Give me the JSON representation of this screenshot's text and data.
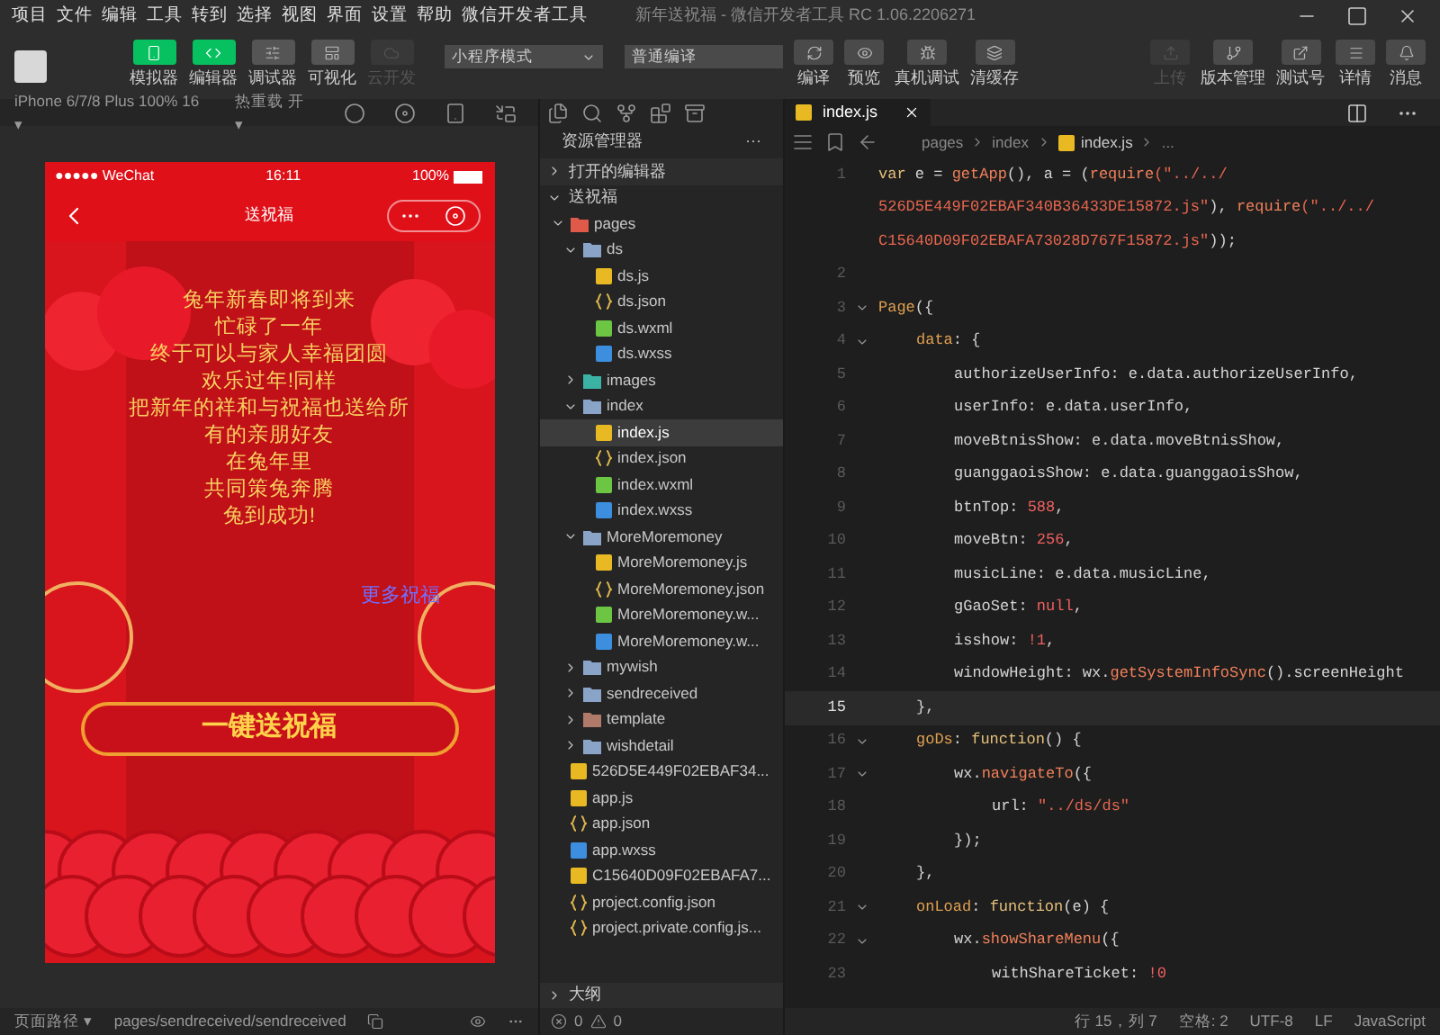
{
  "menu": [
    "项目",
    "文件",
    "编辑",
    "工具",
    "转到",
    "选择",
    "视图",
    "界面",
    "设置",
    "帮助",
    "微信开发者工具"
  ],
  "window": {
    "title": "新年送祝福 - 微信开发者工具 RC 1.06.2206271"
  },
  "toolbar": {
    "view_buttons": [
      {
        "label": "模拟器",
        "kind": "phone",
        "selected": true,
        "disabled": false
      },
      {
        "label": "编辑器",
        "kind": "code",
        "selected": true,
        "disabled": false
      },
      {
        "label": "调试器",
        "kind": "debug",
        "selected": false,
        "disabled": false
      },
      {
        "label": "可视化",
        "kind": "layout",
        "selected": false,
        "disabled": false
      },
      {
        "label": "云开发",
        "kind": "cloud",
        "selected": false,
        "disabled": true
      }
    ],
    "mode_select": "小程序模式",
    "compile_select": "普通编译",
    "actions": [
      {
        "label": "编译",
        "kind": "refresh"
      },
      {
        "label": "预览",
        "kind": "eye"
      },
      {
        "label": "真机调试",
        "kind": "bug"
      },
      {
        "label": "清缓存",
        "kind": "layers"
      }
    ],
    "right_actions": [
      {
        "label": "上传",
        "kind": "upload",
        "disabled": true
      },
      {
        "label": "版本管理",
        "kind": "branch",
        "disabled": false
      },
      {
        "label": "测试号",
        "kind": "external",
        "disabled": false
      },
      {
        "label": "详情",
        "kind": "menu",
        "disabled": false
      },
      {
        "label": "消息",
        "kind": "bell",
        "disabled": false
      }
    ]
  },
  "simulator": {
    "device": "iPhone 6/7/8 Plus 100% 16 ▾",
    "hot_reload": "热重载 开 ▾",
    "status": {
      "carrier": "●●●●● WeChat",
      "time": "16:11",
      "battery": "100%"
    },
    "nav_title": "送祝福",
    "message": [
      "兔年新春即将到来",
      "忙碌了一年",
      "终于可以与家人幸福团圆",
      "欢乐过年!同样",
      "把新年的祥和与祝福也送给所",
      "有的亲朋好友",
      "在兔年里",
      "共同策兔奔腾",
      "兔到成功!"
    ],
    "more_link": "更多祝福",
    "send_button": "一键送祝福"
  },
  "explorer": {
    "title": "资源管理器",
    "menu": "···",
    "open_editors": "打开的编辑器",
    "project": "送祝福",
    "tree": [
      {
        "name": "pages",
        "kind": "pages",
        "expanded": true,
        "selected": false,
        "children": [
          {
            "name": "ds",
            "kind": "folder",
            "expanded": true,
            "selected": false,
            "children": [
              {
                "name": "ds.js",
                "kind": "js",
                "selected": false
              },
              {
                "name": "ds.json",
                "kind": "json",
                "selected": false
              },
              {
                "name": "ds.wxml",
                "kind": "wxml",
                "selected": false
              },
              {
                "name": "ds.wxss",
                "kind": "wxss",
                "selected": false
              }
            ]
          },
          {
            "name": "images",
            "kind": "images",
            "expanded": false,
            "selected": false
          },
          {
            "name": "index",
            "kind": "folder",
            "expanded": true,
            "selected": false,
            "children": [
              {
                "name": "index.js",
                "kind": "js",
                "selected": true
              },
              {
                "name": "index.json",
                "kind": "json",
                "selected": false
              },
              {
                "name": "index.wxml",
                "kind": "wxml",
                "selected": false
              },
              {
                "name": "index.wxss",
                "kind": "wxss",
                "selected": false
              }
            ]
          },
          {
            "name": "MoreMoremoney",
            "kind": "folder",
            "expanded": true,
            "selected": false,
            "children": [
              {
                "name": "MoreMoremoney.js",
                "kind": "js",
                "selected": false
              },
              {
                "name": "MoreMoremoney.json",
                "kind": "json",
                "selected": false
              },
              {
                "name": "MoreMoremoney.w...",
                "kind": "wxml",
                "selected": false
              },
              {
                "name": "MoreMoremoney.w...",
                "kind": "wxss",
                "selected": false
              }
            ]
          },
          {
            "name": "mywish",
            "kind": "folder",
            "expanded": false,
            "selected": false
          },
          {
            "name": "sendreceived",
            "kind": "folder",
            "expanded": false,
            "selected": false
          },
          {
            "name": "template",
            "kind": "template",
            "expanded": false,
            "selected": false
          },
          {
            "name": "wishdetail",
            "kind": "folder",
            "expanded": false,
            "selected": false
          }
        ]
      },
      {
        "name": "526D5E449F02EBAF34...",
        "kind": "js",
        "selected": false
      },
      {
        "name": "app.js",
        "kind": "js",
        "selected": false
      },
      {
        "name": "app.json",
        "kind": "json",
        "selected": false
      },
      {
        "name": "app.wxss",
        "kind": "wxss",
        "selected": false
      },
      {
        "name": "C15640D09F02EBAFA7...",
        "kind": "js",
        "selected": false
      },
      {
        "name": "project.config.json",
        "kind": "json",
        "selected": false
      },
      {
        "name": "project.private.config.js...",
        "kind": "json",
        "selected": false
      }
    ],
    "outline": "大纲",
    "errors": "0",
    "warnings": "0"
  },
  "editor": {
    "tab": "index.js",
    "breadcrumb": [
      "pages",
      "index",
      "index.js",
      "..."
    ],
    "lines": [
      {
        "number": "1",
        "current": false,
        "tokens": [
          {
            "text": "var ",
            "kind": "keyword"
          },
          {
            "text": "e = ",
            "kind": "plain"
          },
          {
            "text": "getApp",
            "kind": "function"
          },
          {
            "text": "(), a = (",
            "kind": "plain"
          },
          {
            "text": "require",
            "kind": "function"
          },
          {
            "text": "(\"../../",
            "kind": "string"
          }
        ]
      },
      {
        "current": false,
        "tokens": [
          {
            "text": "526D5E449F02EBAF340B36433DE15872.js\"",
            "kind": "string"
          },
          {
            "text": "), ",
            "kind": "plain"
          },
          {
            "text": "require",
            "kind": "function"
          },
          {
            "text": "(\"../../",
            "kind": "string"
          }
        ]
      },
      {
        "current": false,
        "tokens": [
          {
            "text": "C15640D09F02EBAFA73028D767F15872.js\"",
            "kind": "string"
          },
          {
            "text": "));",
            "kind": "plain"
          }
        ]
      },
      {
        "number": "2",
        "current": false
      },
      {
        "number": "3",
        "current": false,
        "tokens": [
          {
            "text": "Page",
            "kind": "key"
          },
          {
            "text": "({",
            "kind": "plain"
          }
        ],
        "children": [
          {
            "number": "4",
            "current": false,
            "tokens": [
              {
                "text": "data",
                "kind": "key"
              },
              {
                "text": ": {",
                "kind": "plain"
              }
            ],
            "children": [
              {
                "number": "5",
                "current": false,
                "tokens": [
                  {
                    "text": "authorizeUserInfo: e.data.authorizeUserInfo,",
                    "kind": "plain"
                  }
                ]
              },
              {
                "number": "6",
                "current": false,
                "tokens": [
                  {
                    "text": "userInfo: e.data.userInfo,",
                    "kind": "plain"
                  }
                ]
              },
              {
                "number": "7",
                "current": false,
                "tokens": [
                  {
                    "text": "moveBtnisShow: e.data.moveBtnisShow,",
                    "kind": "plain"
                  }
                ]
              },
              {
                "number": "8",
                "current": false,
                "tokens": [
                  {
                    "text": "guanggaoisShow: e.data.guanggaoisShow,",
                    "kind": "plain"
                  }
                ]
              },
              {
                "number": "9",
                "current": false,
                "tokens": [
                  {
                    "text": "btnTop: ",
                    "kind": "plain"
                  },
                  {
                    "text": "588",
                    "kind": "number"
                  },
                  {
                    "text": ",",
                    "kind": "plain"
                  }
                ]
              },
              {
                "number": "10",
                "current": false,
                "tokens": [
                  {
                    "text": "moveBtn: ",
                    "kind": "plain"
                  },
                  {
                    "text": "256",
                    "kind": "number"
                  },
                  {
                    "text": ",",
                    "kind": "plain"
                  }
                ]
              },
              {
                "number": "11",
                "current": false,
                "tokens": [
                  {
                    "text": "musicLine: e.data.musicLine,",
                    "kind": "plain"
                  }
                ]
              },
              {
                "number": "12",
                "current": false,
                "tokens": [
                  {
                    "text": "gGaoSet: ",
                    "kind": "plain"
                  },
                  {
                    "text": "null",
                    "kind": "number"
                  },
                  {
                    "text": ",",
                    "kind": "plain"
                  }
                ]
              },
              {
                "number": "13",
                "current": false,
                "tokens": [
                  {
                    "text": "isshow: ",
                    "kind": "plain"
                  },
                  {
                    "text": "!1",
                    "kind": "number"
                  },
                  {
                    "text": ",",
                    "kind": "plain"
                  }
                ]
              },
              {
                "number": "14",
                "current": false,
                "tokens": [
                  {
                    "text": "windowHeight: wx.",
                    "kind": "plain"
                  },
                  {
                    "text": "getSystemInfoSync",
                    "kind": "function"
                  },
                  {
                    "text": "().screenHeight",
                    "kind": "plain"
                  }
                ]
              }
            ]
          },
          {
            "number": "15",
            "current": true,
            "tokens": [
              {
                "text": "},",
                "kind": "plain"
              }
            ]
          },
          {
            "number": "16",
            "current": false,
            "tokens": [
              {
                "text": "goDs",
                "kind": "key"
              },
              {
                "text": ": ",
                "kind": "plain"
              },
              {
                "text": "function",
                "kind": "keyword"
              },
              {
                "text": "() {",
                "kind": "plain"
              }
            ],
            "children": [
              {
                "number": "17",
                "current": false,
                "tokens": [
                  {
                    "text": "wx.",
                    "kind": "plain"
                  },
                  {
                    "text": "navigateTo",
                    "kind": "function"
                  },
                  {
                    "text": "({",
                    "kind": "plain"
                  }
                ],
                "children": [
                  {
                    "number": "18",
                    "current": false,
                    "tokens": [
                      {
                        "text": "url: ",
                        "kind": "plain"
                      },
                      {
                        "text": "\"../ds/ds\"",
                        "kind": "string"
                      }
                    ]
                  }
                ]
              },
              {
                "number": "19",
                "current": false,
                "tokens": [
                  {
                    "text": "});",
                    "kind": "plain"
                  }
                ]
              }
            ]
          },
          {
            "number": "20",
            "current": false,
            "tokens": [
              {
                "text": "},",
                "kind": "plain"
              }
            ]
          },
          {
            "number": "21",
            "current": false,
            "tokens": [
              {
                "text": "onLoad",
                "kind": "key"
              },
              {
                "text": ": ",
                "kind": "plain"
              },
              {
                "text": "function",
                "kind": "keyword"
              },
              {
                "text": "(e) {",
                "kind": "plain"
              }
            ],
            "children": [
              {
                "number": "22",
                "current": false,
                "tokens": [
                  {
                    "text": "wx.",
                    "kind": "plain"
                  },
                  {
                    "text": "showShareMenu",
                    "kind": "function"
                  },
                  {
                    "text": "({",
                    "kind": "plain"
                  }
                ],
                "children": [
                  {
                    "number": "23",
                    "current": false,
                    "tokens": [
                      {
                        "text": "withShareTicket: ",
                        "kind": "plain"
                      },
                      {
                        "text": "!0",
                        "kind": "number"
                      }
                    ]
                  }
                ]
              }
            ]
          }
        ]
      }
    ],
    "status": [
      "行 15，列 7",
      "空格: 2",
      "UTF-8",
      "LF",
      "JavaScript"
    ]
  },
  "footer": {
    "page_path_label": "页面路径 ▾",
    "page_path": "pages/sendreceived/sendreceived"
  }
}
